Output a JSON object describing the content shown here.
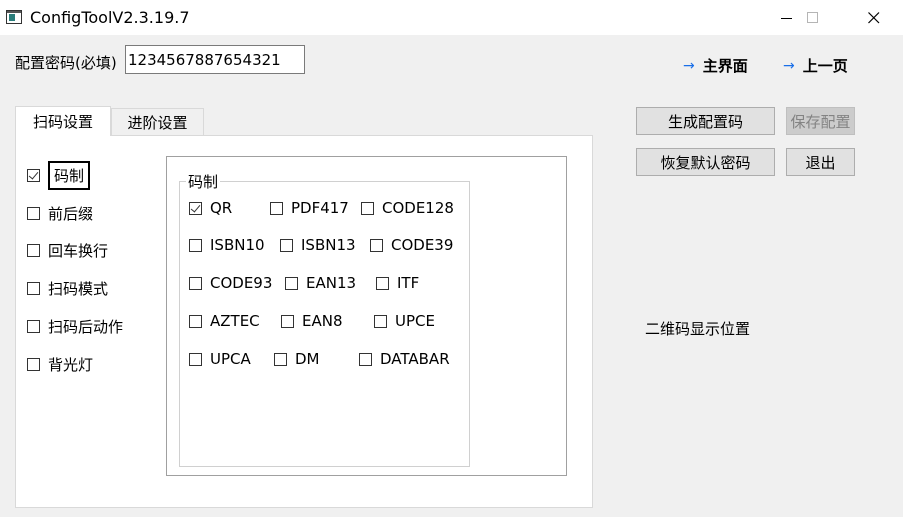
{
  "window": {
    "title": "ConfigToolV2.3.19.7"
  },
  "password": {
    "label": "配置密码(必填)",
    "value": "1234567887654321"
  },
  "nav": {
    "main": "主界面",
    "prev": "上一页"
  },
  "tabs": [
    {
      "label": "扫码设置",
      "active": true
    },
    {
      "label": "进阶设置",
      "active": false
    }
  ],
  "side_options": [
    {
      "label": "码制",
      "checked": true
    },
    {
      "label": "前后缀",
      "checked": false
    },
    {
      "label": "回车换行",
      "checked": false
    },
    {
      "label": "扫码模式",
      "checked": false
    },
    {
      "label": "扫码后动作",
      "checked": false
    },
    {
      "label": "背光灯",
      "checked": false
    }
  ],
  "symbology_group": {
    "title": "码制",
    "items": [
      {
        "label": "QR",
        "checked": true
      },
      {
        "label": "PDF417",
        "checked": false
      },
      {
        "label": "CODE128",
        "checked": false
      },
      {
        "label": "ISBN10",
        "checked": false
      },
      {
        "label": "ISBN13",
        "checked": false
      },
      {
        "label": "CODE39",
        "checked": false
      },
      {
        "label": "CODE93",
        "checked": false
      },
      {
        "label": "EAN13",
        "checked": false
      },
      {
        "label": "ITF",
        "checked": false
      },
      {
        "label": "AZTEC",
        "checked": false
      },
      {
        "label": "EAN8",
        "checked": false
      },
      {
        "label": "UPCE",
        "checked": false
      },
      {
        "label": "UPCA",
        "checked": false
      },
      {
        "label": "DM",
        "checked": false
      },
      {
        "label": "DATABAR",
        "checked": false
      }
    ]
  },
  "actions": {
    "generate": "生成配置码",
    "save": "保存配置",
    "restore": "恢复默认密码",
    "exit": "退出"
  },
  "qr_placeholder": "二维码显示位置",
  "colors": {
    "window_bg": "#f0f0f0",
    "accent_arrow": "#1a6fe8",
    "app_icon": "#2a7d7a"
  }
}
